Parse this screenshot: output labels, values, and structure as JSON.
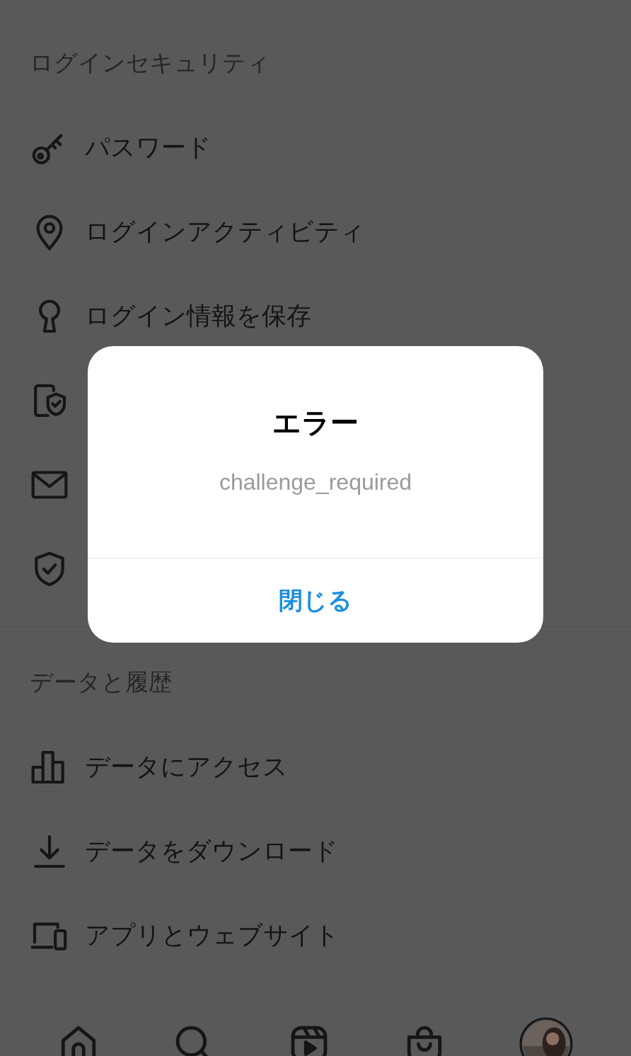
{
  "sections": [
    {
      "title": "ログインセキュリティ",
      "items": [
        {
          "kind": "key",
          "label": "パスワード"
        },
        {
          "kind": "pin",
          "label": "ログインアクティビティ"
        },
        {
          "kind": "keyhole",
          "label": "ログイン情報を保存"
        },
        {
          "kind": "shield-doc"
        },
        {
          "kind": "mail"
        },
        {
          "kind": "shield"
        }
      ]
    },
    {
      "title": "データと履歴",
      "items": [
        {
          "kind": "chart",
          "label": "データにアクセス"
        },
        {
          "kind": "download",
          "label": "データをダウンロード"
        },
        {
          "kind": "laptop",
          "label": "アプリとウェブサイト"
        }
      ]
    }
  ],
  "dialog": {
    "title": "エラー",
    "message": "challenge_required",
    "button": "閉じる"
  },
  "nav": [
    {
      "kind": "home"
    },
    {
      "kind": "search"
    },
    {
      "kind": "reels"
    },
    {
      "kind": "shop"
    },
    {
      "kind": "profile"
    }
  ]
}
